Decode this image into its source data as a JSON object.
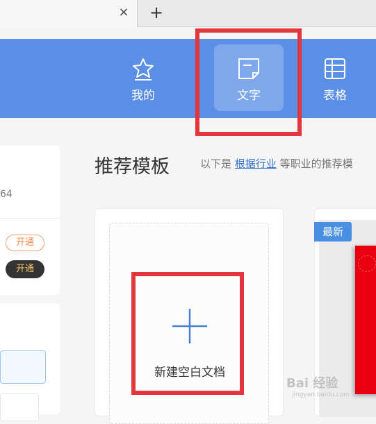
{
  "browser": {
    "tab_close_glyph": "×",
    "new_tab_glyph": "+"
  },
  "nav": {
    "items": [
      {
        "label": "我的",
        "icon": "star-icon"
      },
      {
        "label": "文字",
        "icon": "document-icon"
      },
      {
        "label": "表格",
        "icon": "table-icon"
      }
    ],
    "selected": "文字"
  },
  "left_panel": {
    "partial_number": "64",
    "badge_outline": "开通",
    "badge_dark": "开通"
  },
  "recommend": {
    "title": "推荐模板",
    "desc_prefix": "以下是 ",
    "desc_link": "根据行业",
    "desc_suffix": " 等职业的推荐模"
  },
  "templates": {
    "blank_label": "新建空白文档",
    "new_tag": "最新"
  },
  "watermark": {
    "main": "Bai 经验",
    "sub": "jingyan.baidu.com"
  },
  "colors": {
    "header_blue": "#5b8fe6",
    "annotation_red": "#e2353c",
    "link_blue": "#3572c9",
    "tag_blue": "#4a90e2"
  }
}
